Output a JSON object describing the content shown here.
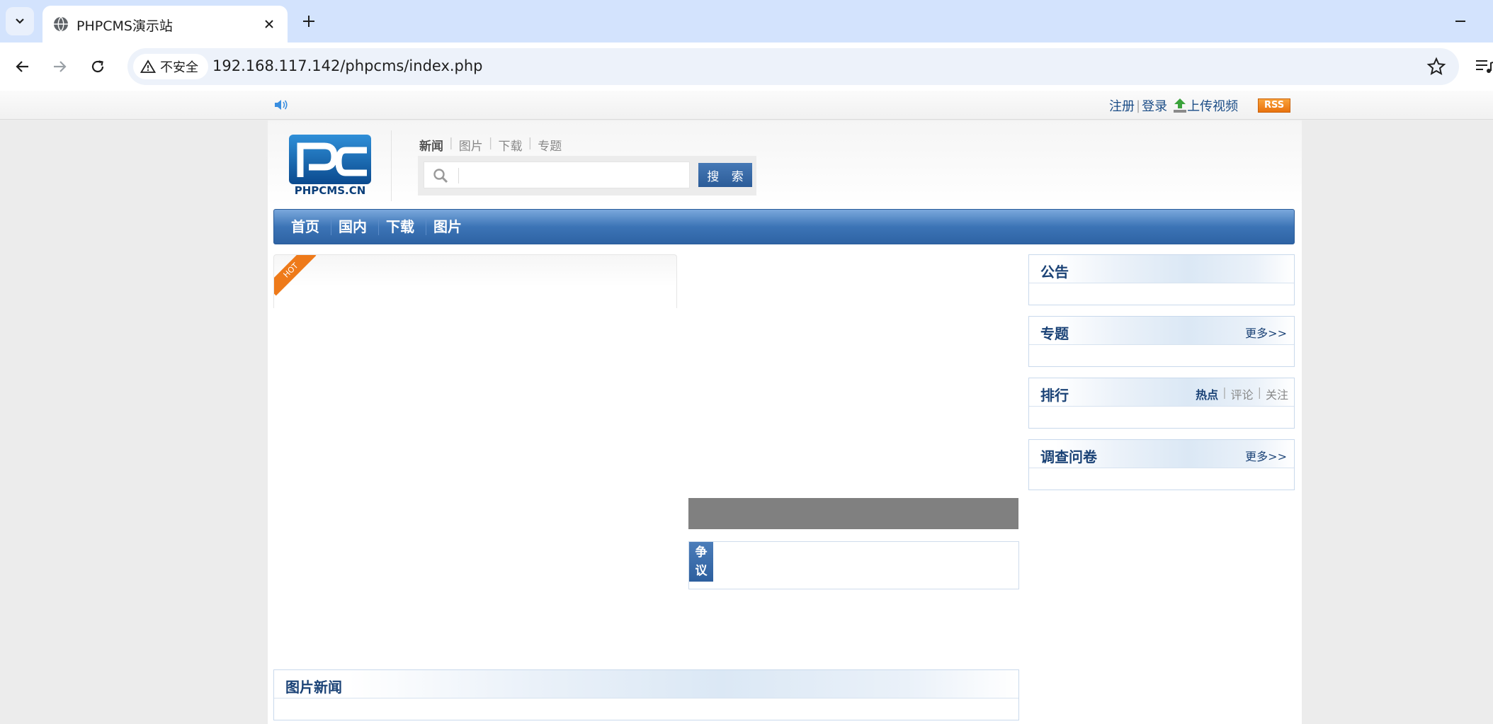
{
  "browser": {
    "tab_title": "PHPCMS演示站",
    "security_label": "不安全",
    "url": "192.168.117.142/phpcms/index.php"
  },
  "topbar": {
    "register": "注册",
    "login": "登录",
    "upload_video": "上传视频",
    "rss": "RSS"
  },
  "header": {
    "logo_text": "PHPCMS.CN",
    "search_tabs": [
      "新闻",
      "图片",
      "下载",
      "专题"
    ],
    "search_button": "搜 索",
    "search_value": ""
  },
  "nav": {
    "items": [
      "首页",
      "国内",
      "下载",
      "图片"
    ]
  },
  "hot": {
    "ribbon": "HOT"
  },
  "controversy": {
    "label": "争议"
  },
  "sidebar": {
    "notice_title": "公告",
    "topic_title": "专题",
    "topic_more": "更多>>",
    "rank_title": "排行",
    "rank_tabs": [
      "热点",
      "评论",
      "关注"
    ],
    "survey_title": "调查问卷",
    "survey_more": "更多>>"
  },
  "picnews": {
    "title": "图片新闻"
  },
  "colors": {
    "nav_blue": "#3c74b6",
    "link_blue": "#1a4276",
    "rss_orange": "#f08a24",
    "hot_orange": "#ee7a1a"
  }
}
